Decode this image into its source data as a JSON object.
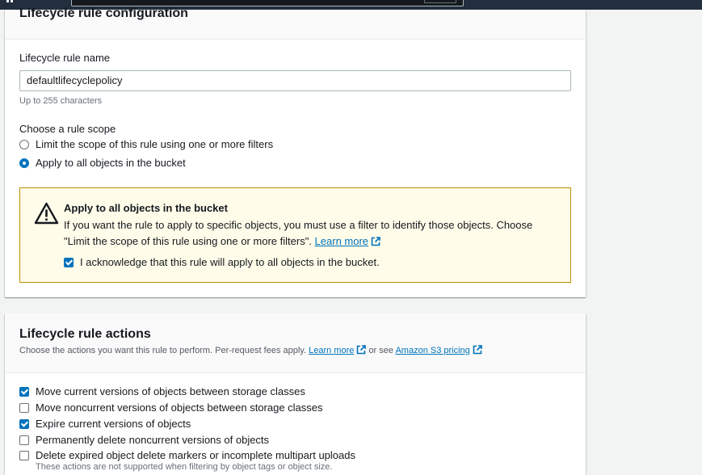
{
  "config": {
    "title": "Lifecycle rule configuration",
    "name_label": "Lifecycle rule name",
    "name_value": "defaultlifecyclepolicy",
    "name_hint": "Up to 255 characters",
    "scope_label": "Choose a rule scope",
    "scope_options": [
      {
        "label": "Limit the scope of this rule using one or more filters",
        "selected": false
      },
      {
        "label": "Apply to all objects in the bucket",
        "selected": true
      }
    ],
    "alert": {
      "title": "Apply to all objects in the bucket",
      "body_line1": "If you want the rule to apply to specific objects, you must use a filter to identify those objects. Choose",
      "body_line2": "\"Limit the scope of this rule using one or more filters\".",
      "learn_more": "Learn more",
      "ack_label": "I acknowledge that this rule will apply to all objects in the bucket.",
      "ack_checked": true
    }
  },
  "actions": {
    "title": "Lifecycle rule actions",
    "desc": "Choose the actions you want this rule to perform. Per-request fees apply.",
    "learn_more": "Learn more",
    "or_see": "or see",
    "pricing_link": "Amazon S3 pricing",
    "items": [
      {
        "label": "Move current versions of objects between storage classes",
        "checked": true
      },
      {
        "label": "Move noncurrent versions of objects between storage classes",
        "checked": false
      },
      {
        "label": "Expire current versions of objects",
        "checked": true
      },
      {
        "label": "Permanently delete noncurrent versions of objects",
        "checked": false
      },
      {
        "label": "Delete expired object delete markers or incomplete multipart uploads",
        "checked": false
      }
    ],
    "note": "These actions are not supported when filtering by object tags or object size."
  },
  "colors": {
    "accent": "#0073bb",
    "warning_border": "#c08f00",
    "warning_bg": "#fffce9",
    "topbar": "#232f3e"
  }
}
